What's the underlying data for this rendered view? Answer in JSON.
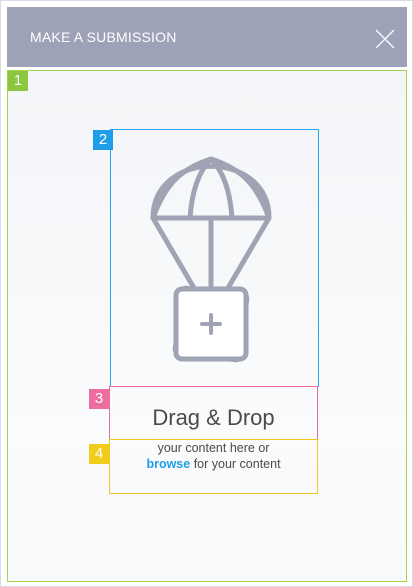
{
  "header": {
    "title": "MAKE A SUBMISSION",
    "close_icon": "close-icon"
  },
  "annotations": {
    "one": "1",
    "two": "2",
    "three": "3",
    "four": "4"
  },
  "dropzone": {
    "illustration_icon": "parachute-icon",
    "title": "Drag & Drop",
    "hint_line1": "your content here or",
    "browse_link": "browse",
    "hint_line2_suffix": " for your content"
  },
  "colors": {
    "header_bg": "#9ea2b6",
    "annotation_green": "#8cc63f",
    "annotation_blue": "#1e9ee8",
    "annotation_pink": "#ee6da0",
    "annotation_yellow": "#f2cc1a",
    "link": "#1e9ee8",
    "icon_gray": "#a0a3b3"
  }
}
